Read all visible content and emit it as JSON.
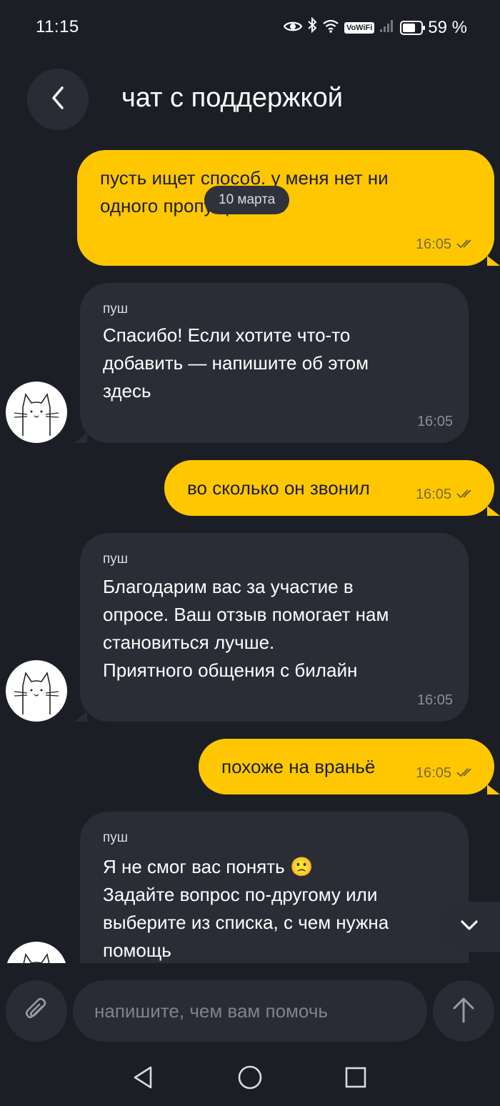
{
  "status_bar": {
    "time": "11:15",
    "vowifi": "VoWiFi",
    "battery_text": "59 %",
    "battery_level": 0.59
  },
  "header": {
    "title": "чат с поддержкой"
  },
  "date_pill": "10 марта",
  "messages": [
    {
      "direction": "outgoing",
      "text_lines": [
        "пусть ищет способ. у меня нет ни",
        "одного пропущенного"
      ],
      "time": "16:05"
    },
    {
      "direction": "incoming",
      "sender": "пуш",
      "text_lines": [
        "Спасибо! Если хотите что-то",
        "добавить — напишите об этом",
        "здесь"
      ],
      "time": "16:05"
    },
    {
      "direction": "outgoing",
      "text_lines": [
        "во сколько он звонил"
      ],
      "time": "16:05"
    },
    {
      "direction": "incoming",
      "sender": "пуш",
      "text_lines": [
        "Благодарим вас за участие в",
        "опросе. Ваш отзыв помогает нам",
        "становиться лучше.",
        "Приятного общения с билайн"
      ],
      "time": "16:05"
    },
    {
      "direction": "outgoing",
      "text_lines": [
        "похоже на враньё"
      ],
      "time": "16:05"
    },
    {
      "direction": "incoming",
      "sender": "пуш",
      "text_lines": [
        "Я не смог вас понять 🙁",
        "Задайте вопрос по-другому или",
        "выберите из списка, с чем нужна",
        "помощь"
      ],
      "time": ""
    }
  ],
  "input": {
    "placeholder": "напишите, чем вам помочь",
    "value": ""
  },
  "icons": {
    "back": "chevron-left-icon",
    "attach": "paperclip-icon",
    "send": "arrow-up-icon",
    "scroll_down": "chevron-down-icon",
    "nav_back": "triangle-back-icon",
    "nav_home": "circle-home-icon",
    "nav_recents": "square-recents-icon"
  },
  "colors": {
    "background": "#1c1e25",
    "outgoing_bubble": "#ffc700",
    "incoming_bubble": "#2a2d36",
    "button_bg": "#292c35"
  }
}
